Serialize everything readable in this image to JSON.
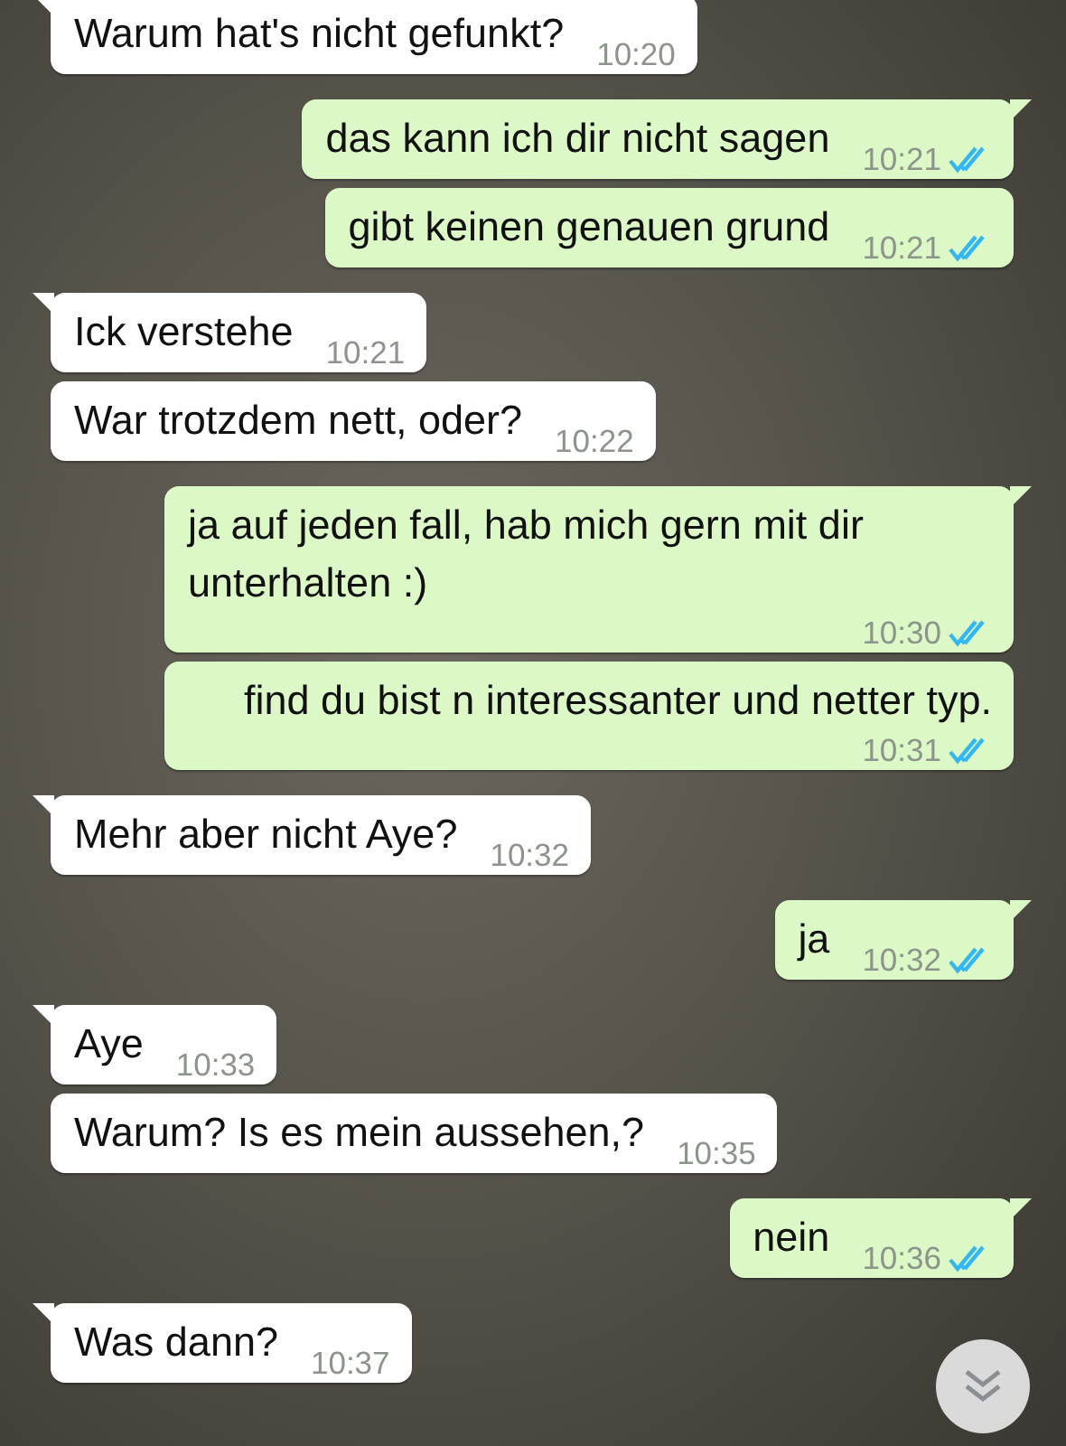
{
  "messages": [
    {
      "kind": "incoming",
      "tail": true,
      "text": "Warum hat's nicht gefunkt?",
      "time": "10:20"
    },
    {
      "kind": "outgoing",
      "tail": true,
      "text": "das kann ich dir nicht sagen",
      "time": "10:21",
      "read": true
    },
    {
      "kind": "outgoing",
      "tail": false,
      "text": "gibt keinen genauen grund",
      "time": "10:21",
      "read": true
    },
    {
      "kind": "incoming",
      "tail": true,
      "text": "Ick verstehe",
      "time": "10:21"
    },
    {
      "kind": "incoming",
      "tail": false,
      "text": "War trotzdem nett, oder?",
      "time": "10:22"
    },
    {
      "kind": "outgoing",
      "tail": true,
      "text": "ja auf jeden fall, hab mich gern mit dir unterhalten :)",
      "time": "10:30",
      "read": true
    },
    {
      "kind": "outgoing",
      "tail": false,
      "text": "find du bist n interessanter und netter typ.",
      "time": "10:31",
      "read": true
    },
    {
      "kind": "incoming",
      "tail": true,
      "text": "Mehr aber nicht Aye?",
      "time": "10:32"
    },
    {
      "kind": "outgoing",
      "tail": true,
      "text": "ja",
      "time": "10:32",
      "read": true
    },
    {
      "kind": "incoming",
      "tail": true,
      "text": "Aye",
      "time": "10:33"
    },
    {
      "kind": "incoming",
      "tail": false,
      "text": "Warum? Is es mein aussehen,?",
      "time": "10:35"
    },
    {
      "kind": "outgoing",
      "tail": true,
      "text": "nein",
      "time": "10:36",
      "read": true
    },
    {
      "kind": "incoming",
      "tail": true,
      "text": "Was dann?",
      "time": "10:37"
    }
  ]
}
